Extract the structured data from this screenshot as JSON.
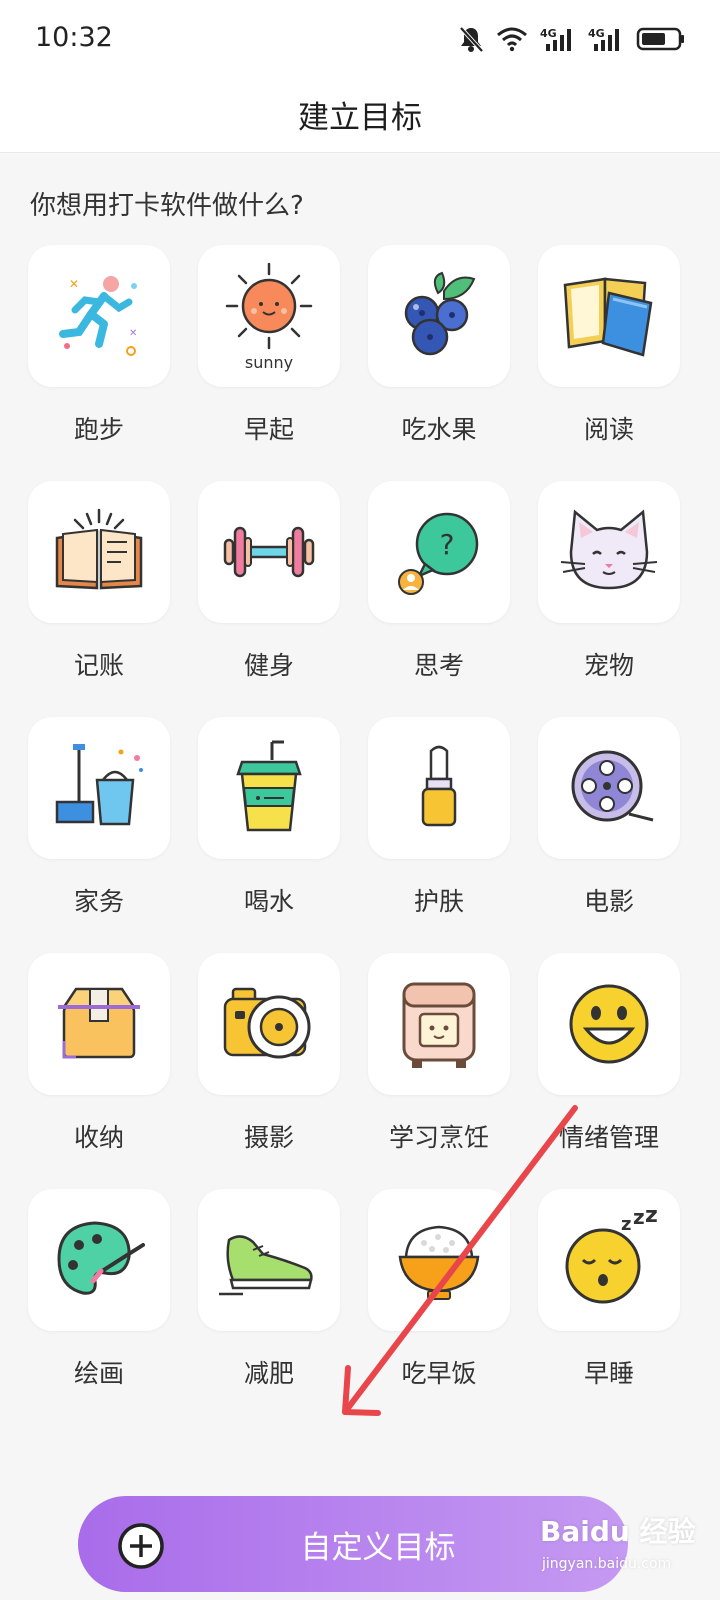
{
  "status_bar": {
    "time": "10:32",
    "icons": [
      "mute-icon",
      "wifi-icon",
      "signal-4g-icon",
      "signal-4g-icon",
      "battery-icon"
    ],
    "network_label": "4G"
  },
  "header": {
    "title": "建立目标"
  },
  "question": "你想用打卡软件做什么?",
  "goals": [
    {
      "label": "跑步",
      "icon": "running-person-icon"
    },
    {
      "label": "早起",
      "icon": "sun-icon",
      "icon_text": "sunny"
    },
    {
      "label": "吃水果",
      "icon": "blueberry-icon"
    },
    {
      "label": "阅读",
      "icon": "books-icon"
    },
    {
      "label": "记账",
      "icon": "open-book-icon"
    },
    {
      "label": "健身",
      "icon": "dumbbell-icon"
    },
    {
      "label": "思考",
      "icon": "question-bubble-icon"
    },
    {
      "label": "宠物",
      "icon": "cat-icon"
    },
    {
      "label": "家务",
      "icon": "mop-bucket-icon"
    },
    {
      "label": "喝水",
      "icon": "drink-cup-icon"
    },
    {
      "label": "护肤",
      "icon": "lipstick-icon"
    },
    {
      "label": "电影",
      "icon": "film-reel-icon"
    },
    {
      "label": "收纳",
      "icon": "box-icon"
    },
    {
      "label": "摄影",
      "icon": "camera-icon"
    },
    {
      "label": "学习烹饪",
      "icon": "rice-cooker-icon"
    },
    {
      "label": "情绪管理",
      "icon": "smiley-icon"
    },
    {
      "label": "绘画",
      "icon": "paint-palette-icon"
    },
    {
      "label": "减肥",
      "icon": "sneaker-icon"
    },
    {
      "label": "吃早饭",
      "icon": "rice-bowl-icon"
    },
    {
      "label": "早睡",
      "icon": "sleepy-face-icon"
    }
  ],
  "custom_button": {
    "label": "自定义目标",
    "icon": "plus-circle-icon"
  },
  "watermark": {
    "brand": "Baidu 经验",
    "url": "jingyan.baidu.com"
  },
  "colors": {
    "accent_start": "#a96cea",
    "accent_end": "#c59af2",
    "annotation_arrow": "#e8464a",
    "page_bg": "#f6f6f6"
  }
}
